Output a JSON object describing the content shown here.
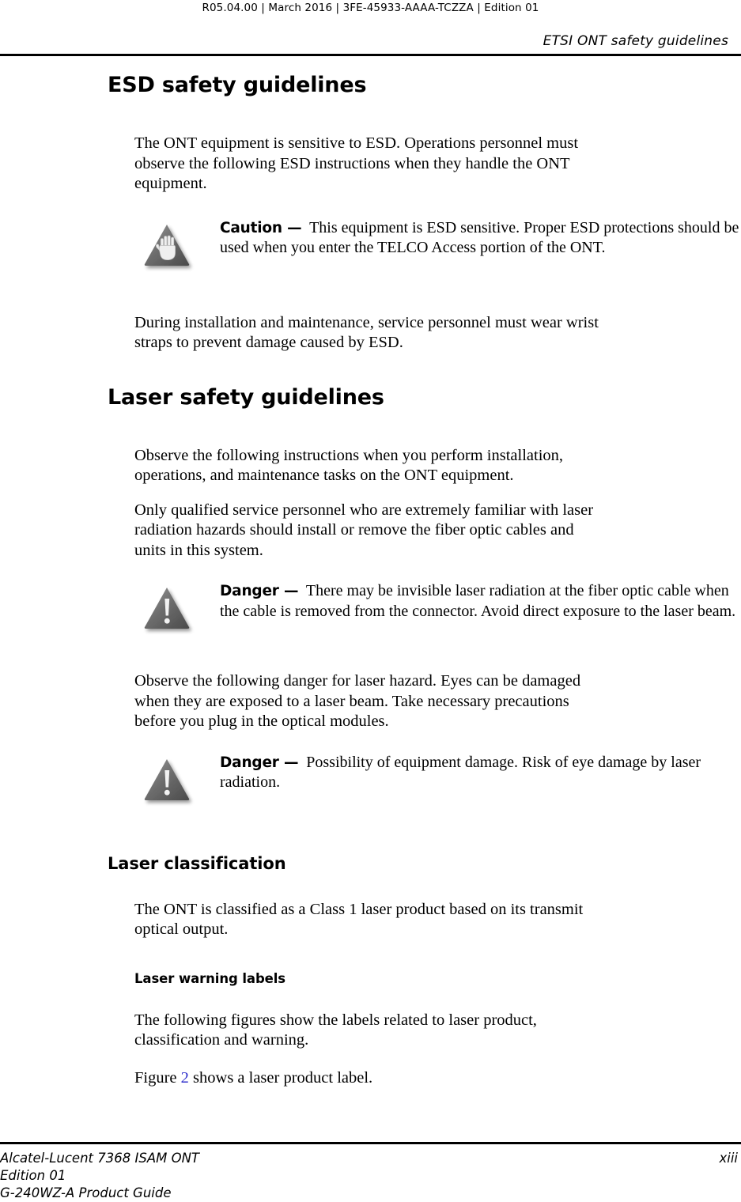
{
  "header": {
    "doc_id": "R05.04.00 | March 2016 | 3FE-45933-AAAA-TCZZA | Edition 01",
    "chapter_title": "ETSI ONT safety guidelines"
  },
  "sections": {
    "esd": {
      "heading": "ESD safety guidelines",
      "intro": "The ONT equipment is sensitive to ESD. Operations personnel must observe the following ESD instructions when they handle the ONT equipment.",
      "caution": {
        "icon": "caution-hand-triangle-icon",
        "label": "Caution —",
        "text": "This equipment is ESD sensitive. Proper ESD protections should be used when you enter the TELCO Access portion of the ONT."
      },
      "outro": "During installation and maintenance, service personnel must wear wrist straps to prevent damage caused by ESD."
    },
    "laser_safety": {
      "heading": "Laser safety guidelines",
      "para1": "Observe the following instructions when you perform installation, operations, and maintenance tasks on the ONT equipment.",
      "para2": "Only qualified service personnel who are extremely familiar with laser radiation hazards should install or remove the fiber optic cables and units in this system.",
      "danger1": {
        "icon": "danger-exclamation-triangle-icon",
        "label": "Danger —",
        "text": "There may be invisible laser radiation at the fiber optic cable when the cable is removed from the connector. Avoid direct exposure to the laser beam."
      },
      "para3": "Observe the following danger for laser hazard. Eyes can be damaged when they are exposed to a laser beam. Take necessary precautions before you plug in the optical modules.",
      "danger2": {
        "icon": "danger-exclamation-triangle-icon",
        "label": "Danger —",
        "text": "Possibility of equipment damage. Risk of eye damage by laser radiation."
      }
    },
    "laser_classification": {
      "heading": "Laser classification",
      "para1": "The ONT is classified as a Class 1 laser product based on its transmit optical output.",
      "subheading": "Laser warning labels",
      "para2": "The following figures show the labels related to laser product, classification and warning.",
      "figure_ref": {
        "before": "Figure ",
        "link": "2",
        "after": " shows a laser product label."
      }
    }
  },
  "footer": {
    "product_lines": "Alcatel-Lucent 7368 ISAM ONT\nEdition 01\nG-240WZ-A Product Guide",
    "page_number": "xiii"
  },
  "colors": {
    "text": "#000000",
    "link": "#3333cc",
    "rule": "#000000",
    "icon_triangle_dark": "#4d4d4d",
    "icon_triangle_light": "#8a8a8a"
  }
}
